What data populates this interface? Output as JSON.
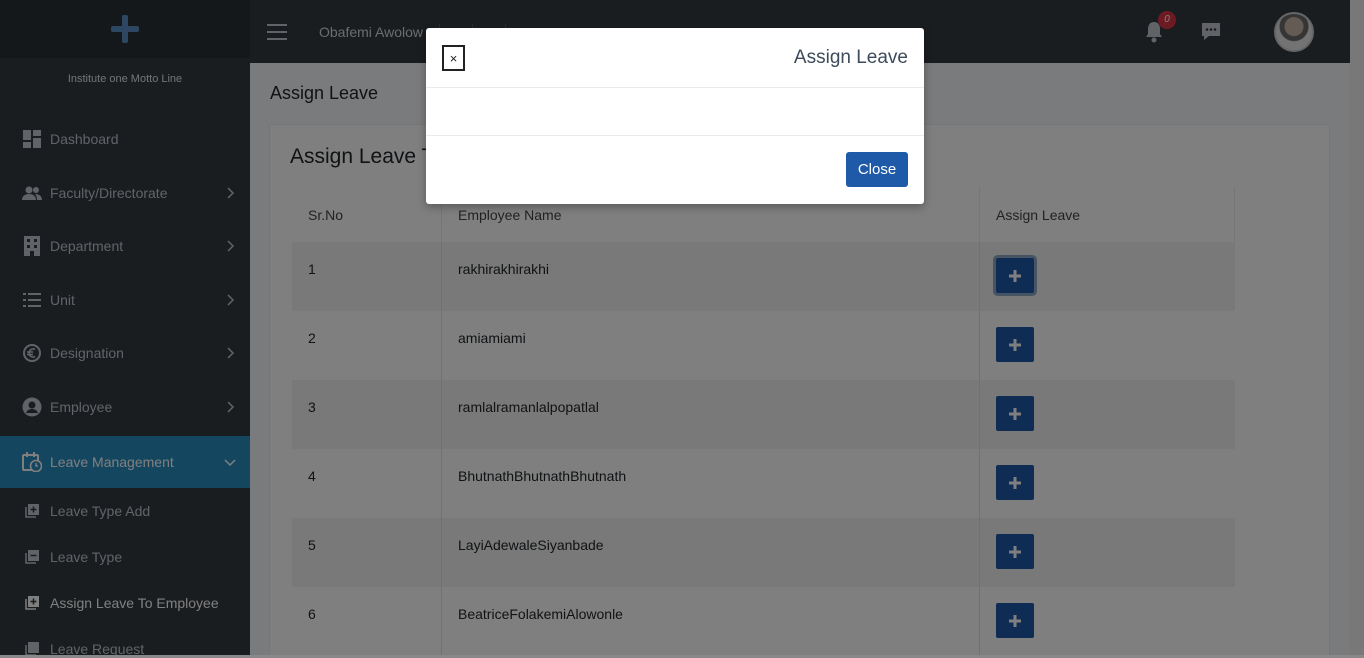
{
  "sidebar": {
    "motto": "Institute one Motto Line",
    "items": [
      {
        "label": "Dashboard",
        "icon": "dashboard-icon"
      },
      {
        "label": "Faculty/Directorate",
        "icon": "users-icon"
      },
      {
        "label": "Department",
        "icon": "building-icon"
      },
      {
        "label": "Unit",
        "icon": "list-icon"
      },
      {
        "label": "Designation",
        "icon": "euro-icon"
      },
      {
        "label": "Employee",
        "icon": "user-circle-icon"
      },
      {
        "label": "Leave Management",
        "icon": "calendar-clock-icon"
      }
    ],
    "sub_items": [
      {
        "label": "Leave Type Add"
      },
      {
        "label": "Leave Type"
      },
      {
        "label": "Assign Leave To Employee"
      },
      {
        "label": "Leave Request"
      }
    ]
  },
  "topbar": {
    "nav": [
      "Obafemi Awolow",
      "",
      "",
      ""
    ],
    "notification_count": "0"
  },
  "page": {
    "title": "Assign Leave",
    "card_title": "Assign Leave T"
  },
  "table": {
    "headers": [
      "Sr.No",
      "Employee Name",
      "Assign Leave"
    ],
    "rows": [
      {
        "sr": "1",
        "name": "rakhirakhirakhi"
      },
      {
        "sr": "2",
        "name": "amiamiami"
      },
      {
        "sr": "3",
        "name": "ramlalramanlalpopatlal"
      },
      {
        "sr": "4",
        "name": "BhutnathBhutnathBhutnath"
      },
      {
        "sr": "5",
        "name": "LayiAdewaleSiyanbade"
      },
      {
        "sr": "6",
        "name": "BeatriceFolakemiAlowonle"
      }
    ]
  },
  "modal": {
    "close_x": "×",
    "title": "Assign Leave",
    "close_button": "Close"
  },
  "colors": {
    "sidebar_bg": "#343a40",
    "active_item": "#2a8dbf",
    "primary_button": "#1f5aa8",
    "badge": "#dc3545"
  }
}
